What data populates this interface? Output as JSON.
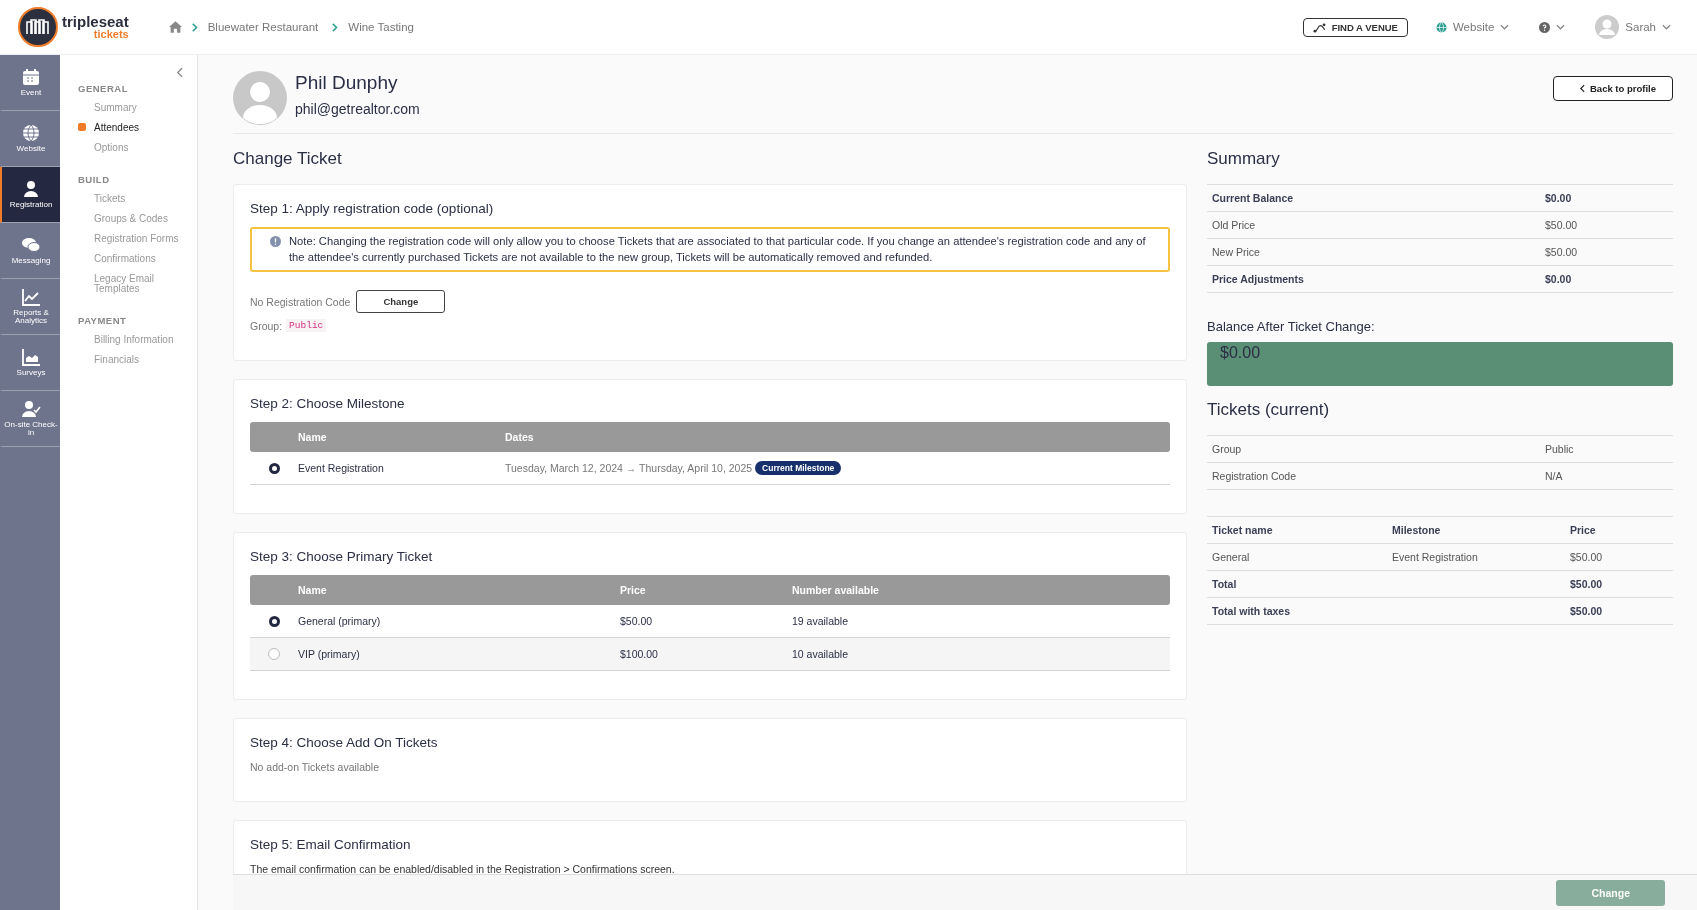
{
  "header": {
    "logo_text": "tripleseat",
    "logo_sub": "tickets",
    "breadcrumbs": [
      "Bluewater Restaurant",
      "Wine Tasting"
    ],
    "find_venue": "FIND A VENUE",
    "website_menu": "Website",
    "user": "Sarah"
  },
  "rail": [
    {
      "label": "Event",
      "selected": false
    },
    {
      "label": "Website",
      "selected": false
    },
    {
      "label": "Registration",
      "selected": true
    },
    {
      "label": "Messaging",
      "selected": false
    },
    {
      "label": "Reports & Analytics",
      "selected": false
    },
    {
      "label": "Surveys",
      "selected": false
    },
    {
      "label": "On-site Check-in",
      "selected": false
    }
  ],
  "subnav": [
    {
      "title": "GENERAL",
      "items": [
        {
          "label": "Summary",
          "selected": false
        },
        {
          "label": "Attendees",
          "selected": true
        },
        {
          "label": "Options",
          "selected": false
        }
      ]
    },
    {
      "title": "BUILD",
      "items": [
        {
          "label": "Tickets",
          "selected": false
        },
        {
          "label": "Groups & Codes",
          "selected": false
        },
        {
          "label": "Registration Forms",
          "selected": false
        },
        {
          "label": "Confirmations",
          "selected": false
        },
        {
          "label": "Legacy Email Templates",
          "selected": false
        }
      ]
    },
    {
      "title": "PAYMENT",
      "items": [
        {
          "label": "Billing Information",
          "selected": false
        },
        {
          "label": "Financials",
          "selected": false
        }
      ]
    }
  ],
  "profile": {
    "name": "Phil Dunphy",
    "email": "phil@getrealtor.com",
    "back_button": "Back to profile"
  },
  "page_title": "Change Ticket",
  "step1": {
    "title": "Step 1: Apply registration code (optional)",
    "note": "Note: Changing the registration code will only allow you to choose Tickets that are associated to that particular code. If you change an attendee's registration code and any of the attendee's currently purchased Tickets are not available to the new group, Tickets will be automatically removed and refunded.",
    "code_label": "No Registration Code",
    "change_button": "Change",
    "group_label": "Group:",
    "group_value": "Public"
  },
  "step2": {
    "title": "Step 2: Choose Milestone",
    "columns": [
      "Name",
      "Dates"
    ],
    "rows": [
      {
        "name": "Event Registration",
        "dates": "Tuesday, March 12, 2024 → Thursday, April 10, 2025",
        "badge": "Current Milestone",
        "selected": true
      }
    ]
  },
  "step3": {
    "title": "Step 3: Choose Primary Ticket",
    "columns": [
      "Name",
      "Price",
      "Number available"
    ],
    "rows": [
      {
        "name": "General (primary)",
        "price": "$50.00",
        "available": "19 available",
        "selected": true
      },
      {
        "name": "VIP (primary)",
        "price": "$100.00",
        "available": "10 available",
        "selected": false
      }
    ]
  },
  "step4": {
    "title": "Step 4: Choose Add On Tickets",
    "text": "No add-on Tickets available"
  },
  "step5": {
    "title": "Step 5: Email Confirmation",
    "text": "The email confirmation can be enabled/disabled in the Registration > Confirmations screen."
  },
  "summary": {
    "title": "Summary",
    "rows": [
      {
        "label": "Current Balance",
        "value": "$0.00",
        "kind": "bold"
      },
      {
        "label": "Old Price",
        "value": "$50.00",
        "kind": "plain"
      },
      {
        "label": "New Price",
        "value": "$50.00",
        "kind": "plain"
      },
      {
        "label": "Price Adjustments",
        "value": "$0.00",
        "kind": "bold"
      }
    ],
    "balance_title": "Balance After Ticket Change:",
    "balance": "$0.00"
  },
  "tickets_current": {
    "title": "Tickets (current)",
    "info": [
      {
        "label": "Group",
        "value": "Public"
      },
      {
        "label": "Registration Code",
        "value": "N/A"
      }
    ],
    "columns": [
      "Ticket name",
      "Milestone",
      "Price"
    ],
    "rows": [
      {
        "name": "General",
        "milestone": "Event Registration",
        "price": "$50.00",
        "kind": "plain"
      },
      {
        "name": "Total",
        "milestone": "",
        "price": "$50.00",
        "kind": "bold"
      },
      {
        "name": "Total with taxes",
        "milestone": "",
        "price": "$50.00",
        "kind": "bold"
      }
    ]
  },
  "footer": {
    "button": "Change",
    "disabled": true
  }
}
